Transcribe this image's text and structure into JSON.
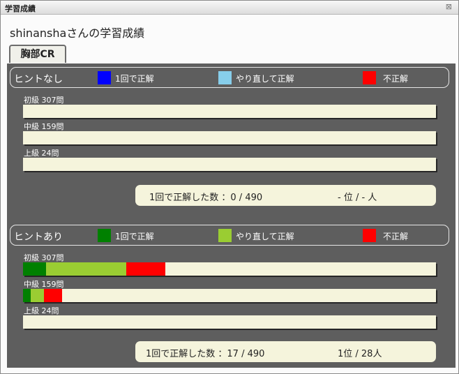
{
  "window": {
    "title": "学習成績",
    "close_glyph": "⊠"
  },
  "heading": "shinanshaさんの学習成績",
  "tab": {
    "label": "胸部CR"
  },
  "sections": [
    {
      "label": "ヒントなし",
      "legend": [
        {
          "label": "1回で正解",
          "color": "#0000ff"
        },
        {
          "label": "やり直して正解",
          "color": "#87ceeb"
        },
        {
          "label": "不正解",
          "color": "#ff0000"
        }
      ],
      "levels": [
        {
          "label": "初級 307問",
          "first_try": 0,
          "retry": 0,
          "wrong": 0
        },
        {
          "label": "中級 159問",
          "first_try": 0,
          "retry": 0,
          "wrong": 0
        },
        {
          "label": "上級 24問",
          "first_try": 0,
          "retry": 0,
          "wrong": 0
        }
      ],
      "stats": {
        "count_text": "1回で正解した数 ：0 / 490",
        "rank_text": "- 位 / - 人"
      }
    },
    {
      "label": "ヒントあり",
      "legend": [
        {
          "label": "1回で正解",
          "color": "#008000"
        },
        {
          "label": "やり直して正解",
          "color": "#9acd32"
        },
        {
          "label": "不正解",
          "color": "#ff0000"
        }
      ],
      "levels": [
        {
          "label": "初級 307問",
          "first_try": 17,
          "retry": 60,
          "wrong": 29
        },
        {
          "label": "中級 159問",
          "first_try": 3,
          "retry": 5,
          "wrong": 7
        },
        {
          "label": "上級 24問",
          "first_try": 0,
          "retry": 0,
          "wrong": 0
        }
      ],
      "stats": {
        "count_text": "1回で正解した数 ：17 / 490",
        "rank_text": "1位 / 28人"
      }
    }
  ]
}
